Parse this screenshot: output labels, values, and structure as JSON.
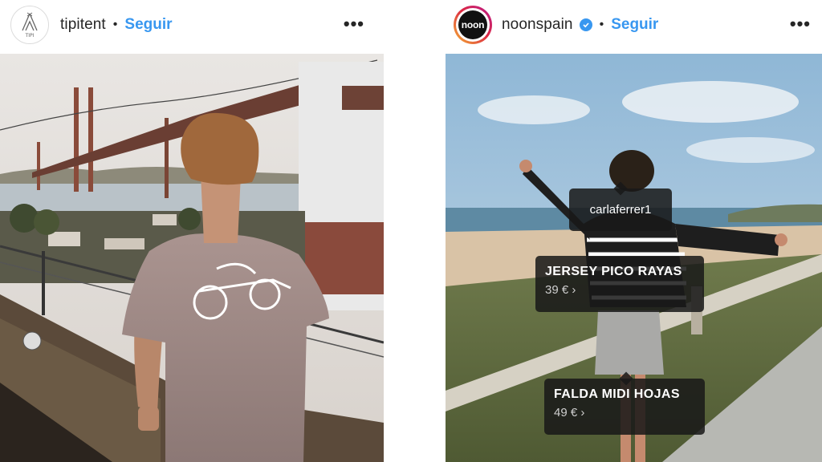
{
  "posts": [
    {
      "username": "tipitent",
      "separator": "•",
      "follow_label": "Seguir",
      "more_label": "•••",
      "avatar_label": "TIPI",
      "verified": false
    },
    {
      "username": "noonspain",
      "separator": "•",
      "follow_label": "Seguir",
      "more_label": "•••",
      "avatar_label": "noon",
      "verified": true,
      "user_tag": "carlaferrer1",
      "product_tags": [
        {
          "name": "JERSEY PICO RAYAS",
          "price": "39 € ›"
        },
        {
          "name": "FALDA MIDI HOJAS",
          "price": "49 € ›"
        }
      ]
    }
  ],
  "colors": {
    "link_blue": "#3897f0",
    "text_dark": "#262626",
    "tag_bg": "#181818"
  },
  "icons": [
    "tipi-tent-logo-icon",
    "verified-badge-icon",
    "more-options-icon"
  ]
}
